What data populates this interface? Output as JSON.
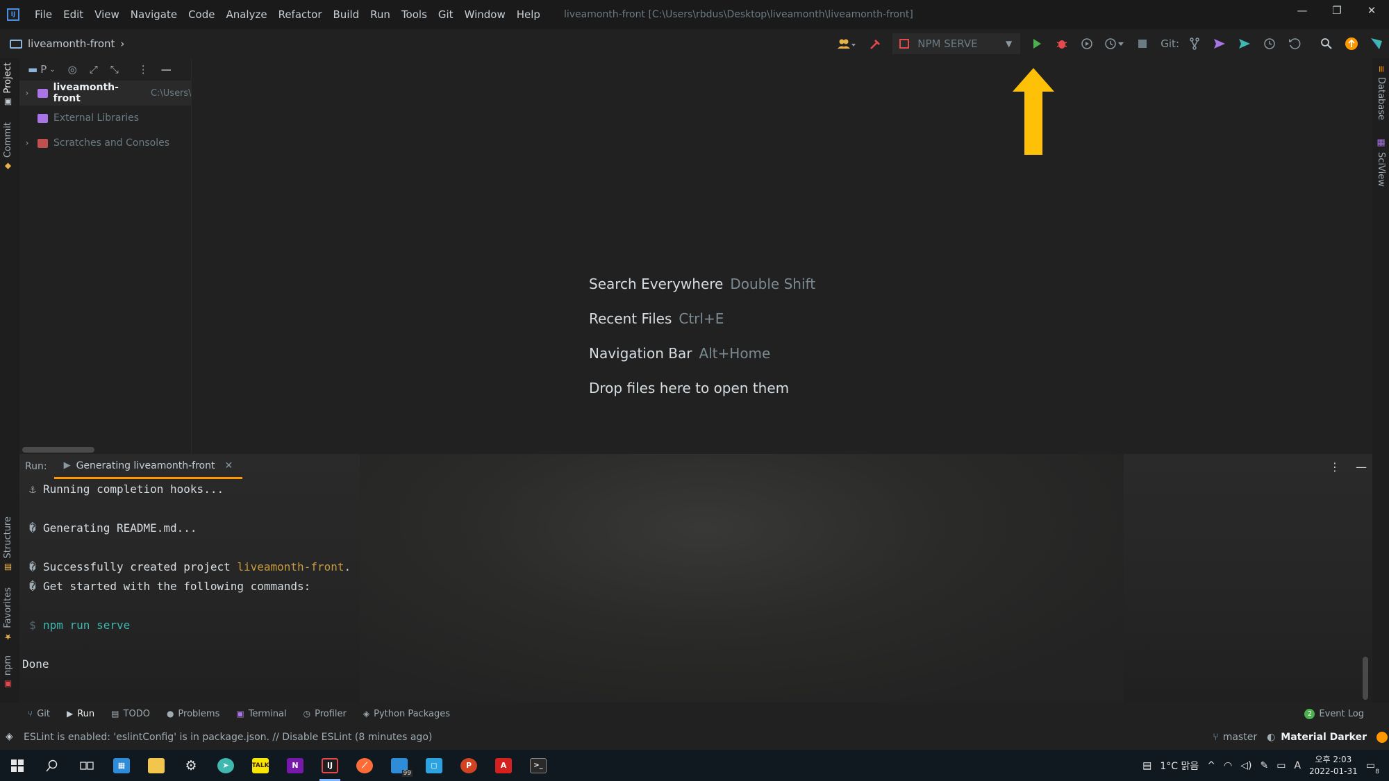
{
  "window": {
    "app_icon": "IJ",
    "title": "liveamonth-front [C:\\Users\\rbdus\\Desktop\\liveamonth\\liveamonth-front]",
    "menu": [
      "File",
      "Edit",
      "View",
      "Navigate",
      "Code",
      "Analyze",
      "Refactor",
      "Build",
      "Run",
      "Tools",
      "Git",
      "Window",
      "Help"
    ],
    "controls": {
      "minimize": "—",
      "restore": "❐",
      "close": "✕"
    }
  },
  "navbar": {
    "breadcrumb": "liveamonth-front",
    "breadcrumb_chevron": "›",
    "run_config": "NPM SERVE",
    "git_label": "Git:"
  },
  "left_strip": {
    "project": "Project",
    "commit": "Commit",
    "structure": "Structure",
    "favorites": "Favorites",
    "npm": "npm"
  },
  "right_strip": {
    "database": "Database",
    "sciview": "SciView"
  },
  "project_panel": {
    "view_label": "P",
    "root_name": "liveamonth-front",
    "root_path": "C:\\Users\\",
    "items": [
      "External Libraries",
      "Scratches and Consoles"
    ]
  },
  "editor": {
    "hints": [
      {
        "label": "Search Everywhere",
        "key": "Double Shift"
      },
      {
        "label": "Recent Files",
        "key": "Ctrl+E"
      },
      {
        "label": "Navigation Bar",
        "key": "Alt+Home"
      }
    ],
    "drop_text": "Drop files here to open them"
  },
  "run_panel": {
    "label": "Run:",
    "tab_label": "Generating liveamonth-front",
    "lines": {
      "l1_prefix": "⚓",
      "l1": "Running completion hooks...",
      "l2_prefix": "�",
      "l2": "Generating README.md...",
      "l3_prefix": "�",
      "l3": "Successfully created project ",
      "l3_project": "liveamonth-front",
      "l3_end": ".",
      "l4_prefix": "�",
      "l4": "Get started with the following commands:",
      "l5_prefix": "$",
      "l5": "npm run serve",
      "l6": "Done"
    }
  },
  "bottom_tools": {
    "items": [
      "Git",
      "Run",
      "TODO",
      "Problems",
      "Terminal",
      "Profiler",
      "Python Packages"
    ],
    "event_log": "Event Log",
    "event_count": "2"
  },
  "status": {
    "message": "ESLint is enabled: 'eslintConfig' is in package.json. // Disable ESLint (8 minutes ago)",
    "branch": "master",
    "theme": "Material Darker"
  },
  "taskbar": {
    "weather": "1°C 맑음",
    "ime": "A",
    "time": "오후 2:03",
    "date": "2022-01-31",
    "notification_count": "99",
    "notif_badge": "8"
  },
  "colors": {
    "accent_orange": "#ff9800",
    "run_green": "#4caf50",
    "debug_red": "#e5484d",
    "arrow_yellow": "#ffc107"
  }
}
